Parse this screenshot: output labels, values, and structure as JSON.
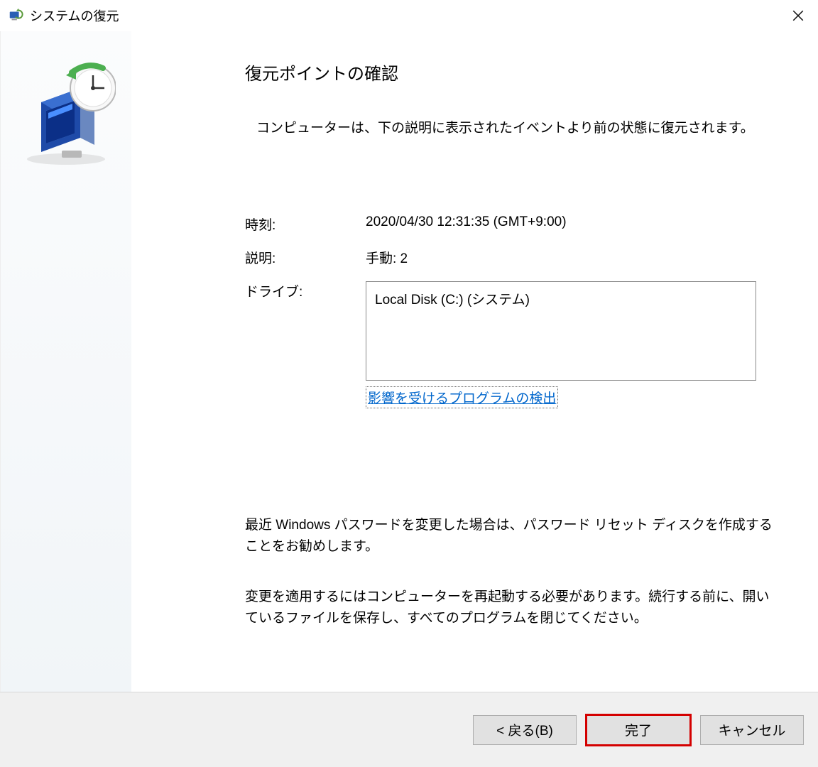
{
  "title": "システムの復元",
  "heading": "復元ポイントの確認",
  "intro": "コンピューターは、下の説明に表示されたイベントより前の状態に復元されます。",
  "labels": {
    "time": "時刻:",
    "description": "説明:",
    "drive": "ドライブ:"
  },
  "values": {
    "time": "2020/04/30 12:31:35 (GMT+9:00)",
    "description": "手動: 2",
    "drive": "Local Disk (C:) (システム)"
  },
  "detectLink": "影響を受けるプログラムの検出",
  "note1": "最近 Windows パスワードを変更した場合は、パスワード リセット ディスクを作成することをお勧めします。",
  "note2": "変更を適用するにはコンピューターを再起動する必要があります。続行する前に、開いているファイルを保存し、すべてのプログラムを閉じてください。",
  "buttons": {
    "back": "< 戻る(B)",
    "finish": "完了",
    "cancel": "キャンセル"
  }
}
